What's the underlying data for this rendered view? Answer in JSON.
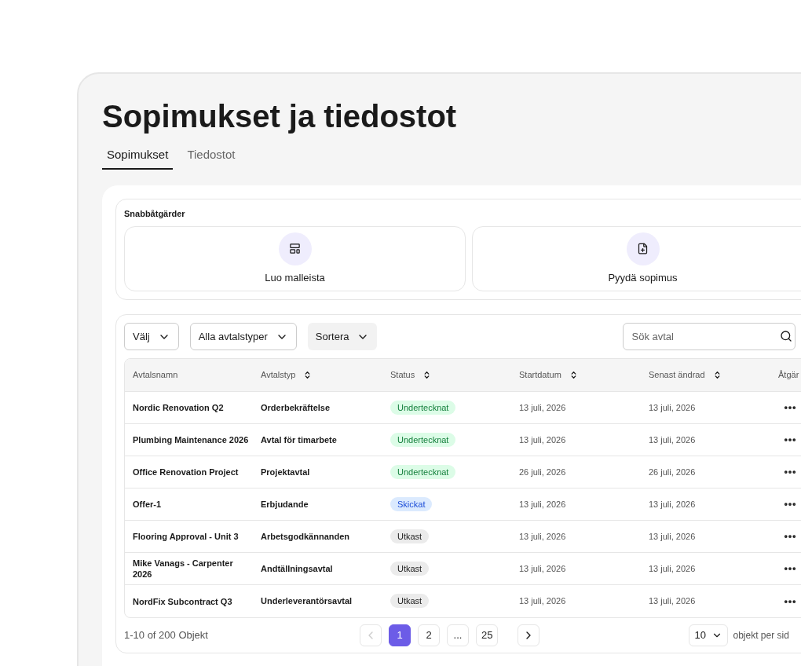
{
  "page": {
    "title": "Sopimukset ja tiedostot"
  },
  "tabs": [
    {
      "label": "Sopimukset",
      "selected": true
    },
    {
      "label": "Tiedostot",
      "selected": false
    }
  ],
  "quick_actions": {
    "title": "Snabbåtgärder",
    "items": [
      {
        "kind": "template",
        "label": "Luo malleista"
      },
      {
        "kind": "request",
        "label": "Pyydä sopimus"
      }
    ]
  },
  "filters": [
    {
      "label": "Välj",
      "kind": "outlined"
    },
    {
      "label": "Alla avtalstyper",
      "kind": "outlined"
    },
    {
      "label": "Sortera",
      "kind": "filled"
    }
  ],
  "search": {
    "placeholder": "Sök avtal"
  },
  "table": {
    "columns": [
      {
        "label": "Avtalsnamn",
        "sortable": false
      },
      {
        "label": "Avtalstyp",
        "sortable": true
      },
      {
        "label": "Status",
        "sortable": true
      },
      {
        "label": "Startdatum",
        "sortable": true
      },
      {
        "label": "Senast ändrad",
        "sortable": true
      },
      {
        "label": "Åtgär"
      }
    ],
    "rows": [
      {
        "name": "Nordic Renovation Q2",
        "type": "Orderbekräftelse",
        "status": {
          "label": "Undertecknat",
          "kind": "signed"
        },
        "start": "13 juli, 2026",
        "modified": "13 juli, 2026"
      },
      {
        "name": "Plumbing Maintenance 2026",
        "type": "Avtal för timarbete",
        "status": {
          "label": "Undertecknat",
          "kind": "signed"
        },
        "start": "13 juli, 2026",
        "modified": "13 juli, 2026"
      },
      {
        "name": "Office Renovation Project",
        "type": "Projektavtal",
        "status": {
          "label": "Undertecknat",
          "kind": "signed"
        },
        "start": "26 juli, 2026",
        "modified": "26 juli, 2026"
      },
      {
        "name": "Offer-1",
        "type": "Erbjudande",
        "status": {
          "label": "Skickat",
          "kind": "sent"
        },
        "start": "13 juli, 2026",
        "modified": "13 juli, 2026"
      },
      {
        "name": "Flooring Approval - Unit 3",
        "type": "Arbetsgodkännanden",
        "status": {
          "label": "Utkast",
          "kind": "draft"
        },
        "start": "13 juli, 2026",
        "modified": "13 juli, 2026"
      },
      {
        "name": "Mike Vanags - Carpenter 2026",
        "type": "Andtällningsavtal",
        "status": {
          "label": "Utkast",
          "kind": "draft"
        },
        "start": "13 juli, 2026",
        "modified": "13 juli, 2026"
      },
      {
        "name": "NordFix Subcontract Q3",
        "type": "Underleverantörsavtal",
        "status": {
          "label": "Utkast",
          "kind": "draft"
        },
        "start": "13 juli, 2026",
        "modified": "13 juli, 2026"
      }
    ]
  },
  "pagination": {
    "summary": "1-10 of 200 Objekt",
    "prev_disabled": true,
    "pages": [
      {
        "label": "1",
        "selected": true
      },
      {
        "label": "2",
        "selected": false
      },
      {
        "label": "...",
        "selected": false
      },
      {
        "label": "25",
        "selected": false
      }
    ],
    "per_page": "10",
    "per_page_label": "objekt per sid"
  }
}
